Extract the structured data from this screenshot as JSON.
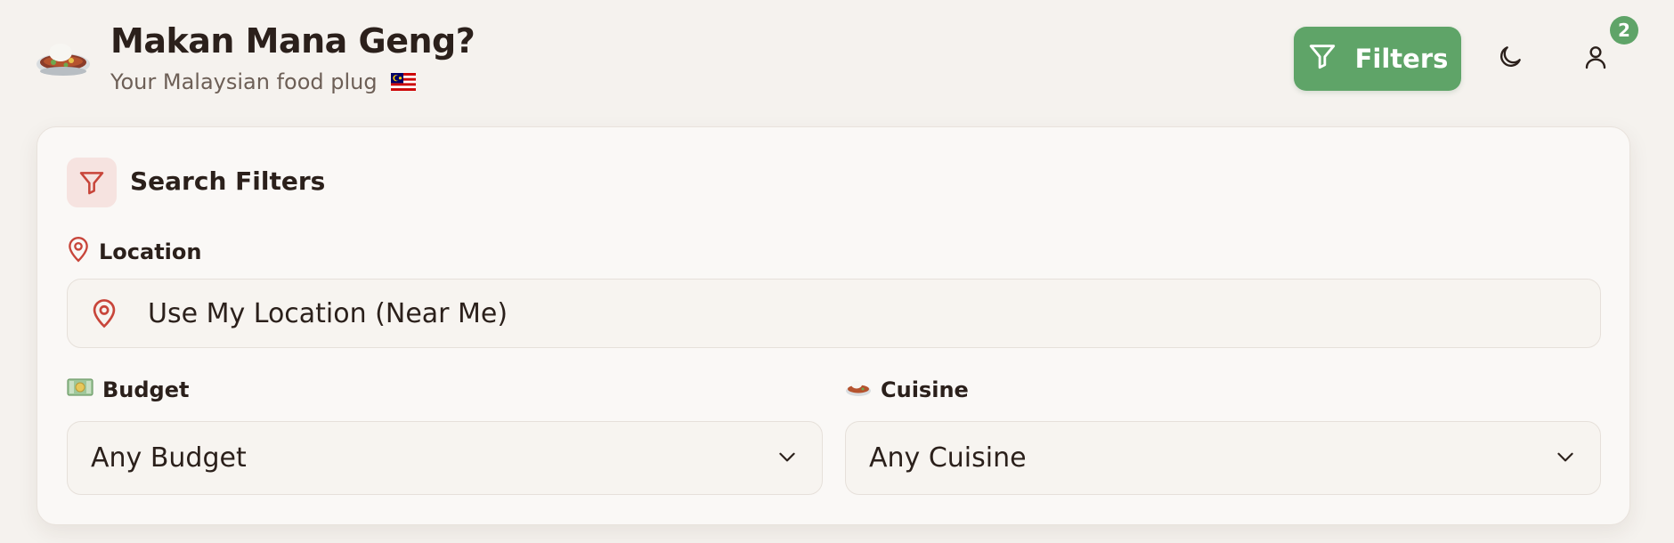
{
  "app": {
    "title": "Makan Mana Geng?",
    "subtitle": "Your Malaysian food plug",
    "logo_icon": "rice-plate-icon",
    "flag_icon": "malaysia-flag-icon"
  },
  "header": {
    "filters_button_label": "Filters",
    "filters_icon": "filter-icon",
    "theme_icon": "moon-icon",
    "account_icon": "user-icon",
    "account_badge_count": "2"
  },
  "filters_panel": {
    "title": "Search Filters",
    "location": {
      "label": "Location",
      "value": "Use My Location (Near Me)"
    },
    "budget": {
      "label": "Budget",
      "label_icon": "money-icon",
      "selected": "Any Budget"
    },
    "cuisine": {
      "label": "Cuisine",
      "label_icon": "curry-bowl-icon",
      "selected": "Any Cuisine"
    }
  },
  "colors": {
    "background": "#f5f2ee",
    "accent_green": "#5fa468",
    "accent_red": "#c8453a",
    "text_dark": "#2b201b",
    "text_muted": "#6d5f56"
  }
}
